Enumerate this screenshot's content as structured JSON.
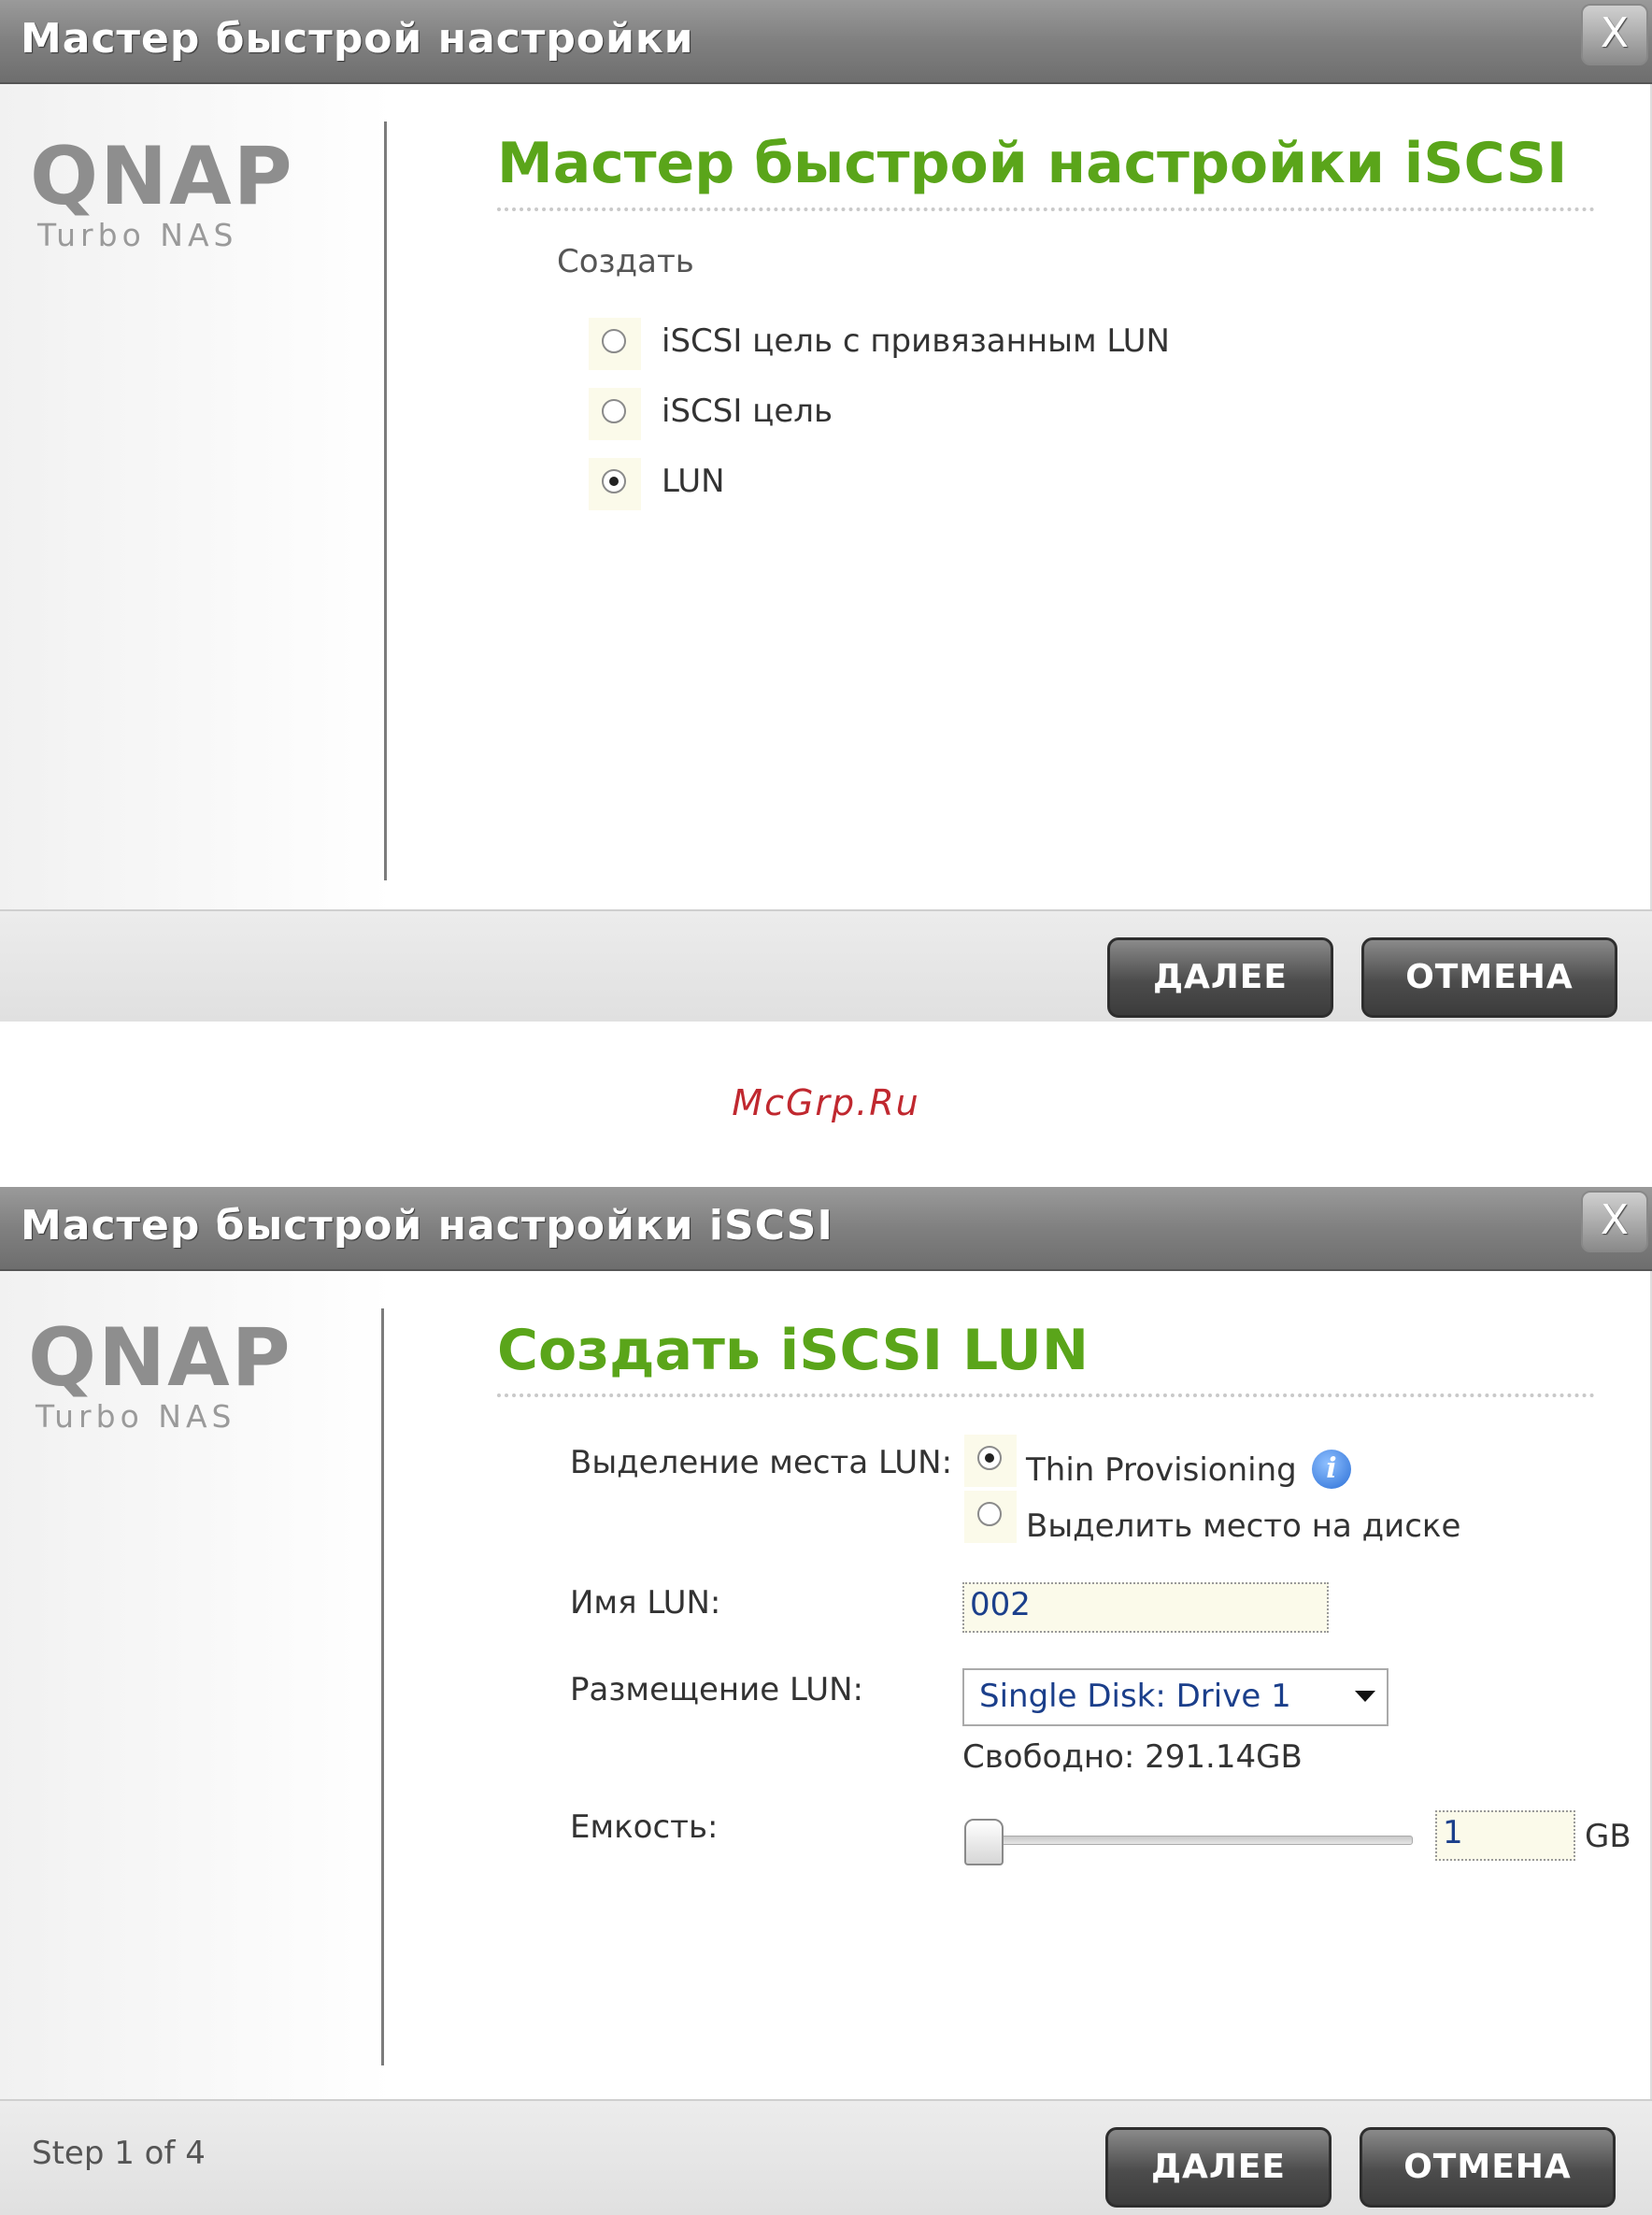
{
  "dialog1": {
    "title": "Мастер быстрой настройки",
    "close_label": "X",
    "logo_main": "QNAP",
    "logo_sub": "Turbo NAS",
    "heading": "Мастер быстрой настройки iSCSI",
    "create_label": "Создать",
    "options": [
      {
        "label": "iSCSI цель с привязанным LUN",
        "checked": false
      },
      {
        "label": "iSCSI цель",
        "checked": false
      },
      {
        "label": "LUN",
        "checked": true
      }
    ],
    "next_label": "ДАЛЕЕ",
    "cancel_label": "ОТМЕНА"
  },
  "watermark": "McGrp.Ru",
  "dialog2": {
    "title": "Мастер быстрой настройки iSCSI",
    "close_label": "X",
    "logo_main": "QNAP",
    "logo_sub": "Turbo NAS",
    "heading": "Создать iSCSI LUN",
    "allocation_label": "Выделение места LUN:",
    "allocation_options": [
      {
        "label": "Thin Provisioning",
        "checked": true
      },
      {
        "label": "Выделить место на диске",
        "checked": false
      }
    ],
    "info_icon": "info-icon",
    "name_label": "Имя LUN:",
    "name_value": "002",
    "location_label": "Размещение LUN:",
    "location_value": "Single Disk: Drive 1",
    "free_text": "Свободно: 291.14GB",
    "capacity_label": "Емкость:",
    "capacity_value": "1",
    "capacity_unit": "GB",
    "step_text": "Step 1 of 4",
    "next_label": "ДАЛЕЕ",
    "cancel_label": "ОТМЕНА"
  },
  "colors": {
    "heading_green": "#5aa51a",
    "titlebar_gray": "#808080",
    "watermark_red": "#c0282f",
    "value_blue": "#1b3f8b"
  }
}
